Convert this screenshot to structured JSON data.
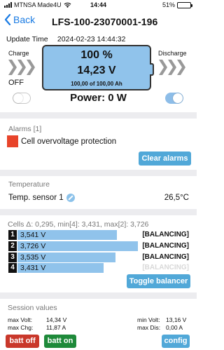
{
  "status_bar": {
    "carrier": "MTNSA Made4U",
    "time": "14:44",
    "battery_pct": "51%",
    "battery_level": 0.51
  },
  "nav": {
    "back_label": "Back",
    "title": "LFS-100-23070001-196"
  },
  "update": {
    "label": "Update Time",
    "value": "2024-02-23 14:44:32"
  },
  "battery": {
    "charge_label": "Charge",
    "discharge_label": "Discharge",
    "percent": "100 %",
    "voltage": "14,23 V",
    "capacity": "100,00 of 100,00 Ah",
    "charge_state": "OFF",
    "charge_on": false,
    "discharge_on": true,
    "power": "Power: 0 W"
  },
  "alarms": {
    "title": "Alarms [1]",
    "items": [
      "Cell overvoltage protection"
    ],
    "clear_label": "Clear alarms",
    "alarm_color": "#e8442a"
  },
  "temperature": {
    "title": "Temperature",
    "sensor_label": "Temp. sensor 1",
    "sensor_value": "26,5°C"
  },
  "cells": {
    "title": "Cells Δ: 0,295, min[4]: 3,431, max[2]: 3,726",
    "items": [
      {
        "num": "1",
        "voltage": "3,541 V",
        "status": "[BALANCING]",
        "fill": 0.58,
        "faded": false
      },
      {
        "num": "2",
        "voltage": "3,726 V",
        "status": "[BALANCING]",
        "fill": 0.7,
        "faded": false
      },
      {
        "num": "3",
        "voltage": "3,535 V",
        "status": "[BALANCING]",
        "fill": 0.57,
        "faded": false
      },
      {
        "num": "4",
        "voltage": "3,431 V",
        "status": "[BALANCING]",
        "fill": 0.5,
        "faded": true
      }
    ],
    "toggle_label": "Toggle balancer"
  },
  "session": {
    "title": "Session values",
    "max_volt_label": "max Volt:",
    "max_volt_value": "14,34 V",
    "min_volt_label": "min Volt:",
    "min_volt_value": "13,16 V",
    "max_chg_label": "max Chg:",
    "max_chg_value": "11,87 A",
    "max_dis_label": "max Dis:",
    "max_dis_value": "0,00 A"
  },
  "footer": {
    "batt_off": "batt off",
    "batt_on": "batt on",
    "config": "config"
  },
  "colors": {
    "accent": "#51a8d8",
    "battery_fill": "#90c3eb",
    "ios_blue": "#1a7be3",
    "batt_off": "#c9382b",
    "batt_on": "#1e8a3a"
  }
}
